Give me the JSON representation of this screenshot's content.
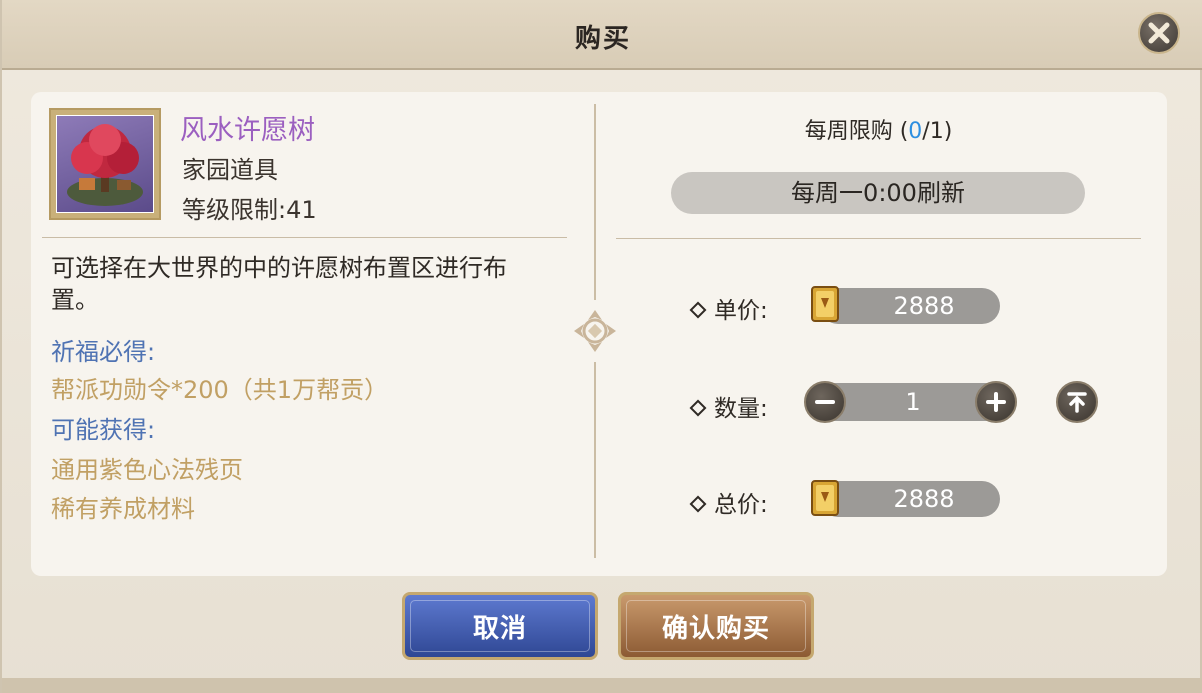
{
  "dialog": {
    "title": "购买",
    "close_icon": "close-icon"
  },
  "item": {
    "name": "风水许愿树",
    "type": "家园道具",
    "level_limit": "等级限制:41",
    "description": "可选择在大世界的中的许愿树布置区进行布置。",
    "blessing_label": "祈福必得:",
    "blessing_reward": "帮派功勋令*200（共1万帮贡）",
    "possible_label": "可能获得:",
    "possible_rewards": [
      "通用紫色心法残页",
      "稀有养成材料"
    ]
  },
  "purchase": {
    "limit_prefix": "每周限购 (",
    "limit_count": "0",
    "limit_suffix": "/1)",
    "refresh_text": "每周一0:00刷新",
    "unit_price_label": "单价:",
    "unit_price": "2888",
    "quantity_label": "数量:",
    "quantity": "1",
    "total_price_label": "总价:",
    "total_price": "2888"
  },
  "buttons": {
    "cancel": "取消",
    "confirm": "确认购买"
  },
  "colors": {
    "item_name": "#9b5fc0",
    "section_label": "#4f73b3",
    "reward_text": "#c1a064",
    "limit_count": "#2e8fe0"
  }
}
